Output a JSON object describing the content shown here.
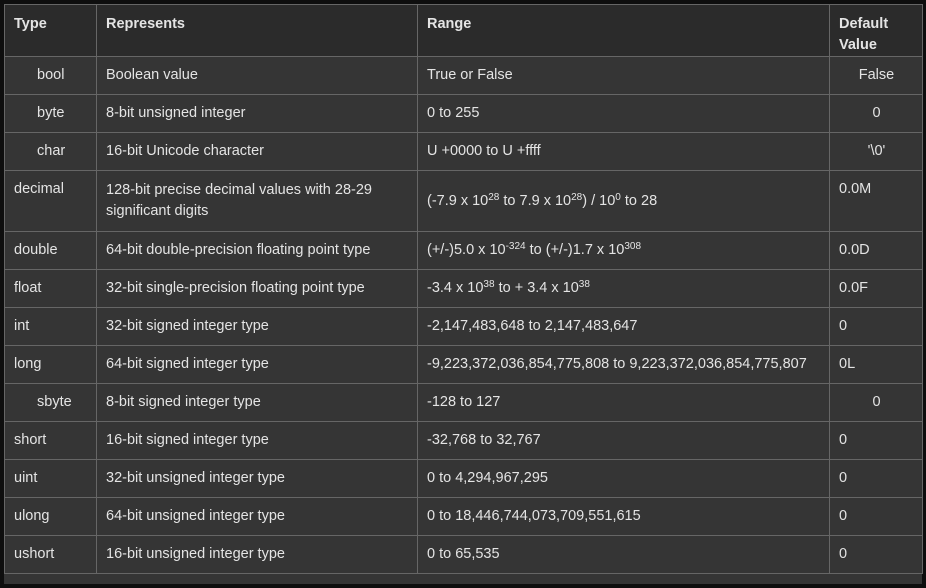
{
  "headers": {
    "type": "Type",
    "represents": "Represents",
    "range": "Range",
    "default": "Default Value"
  },
  "rows": [
    {
      "type": "bool",
      "represents": "Boolean value",
      "range": "True or False",
      "default": "False"
    },
    {
      "type": "byte",
      "represents": "8-bit unsigned integer",
      "range": "0 to 255",
      "default": "0"
    },
    {
      "type": "char",
      "represents": "16-bit Unicode character",
      "range": "U +0000 to U +ffff",
      "default": "'\\0'"
    },
    {
      "type": "decimal",
      "represents": "128-bit precise decimal values with 28-29 significant digits",
      "range_parts": [
        "(-7.9 x 10",
        "28",
        " to 7.9 x 10",
        "28",
        ") / 10",
        "0",
        " to 28"
      ],
      "default": "0.0M"
    },
    {
      "type": "double",
      "represents": "64-bit double-precision floating point type",
      "range_parts": [
        "(+/-)5.0 x 10",
        "-324",
        " to (+/-)1.7 x 10",
        "308"
      ],
      "default": "0.0D"
    },
    {
      "type": "float",
      "represents": "32-bit single-precision floating point type",
      "range_parts": [
        "-3.4 x 10",
        "38",
        " to + 3.4 x 10",
        "38"
      ],
      "default": "0.0F"
    },
    {
      "type": "int",
      "represents": "32-bit signed integer type",
      "range": "-2,147,483,648 to 2,147,483,647",
      "default": "0"
    },
    {
      "type": "long",
      "represents": "64-bit signed integer type",
      "range": "-9,223,372,036,854,775,808 to 9,223,372,036,854,775,807",
      "default": "0L"
    },
    {
      "type": "sbyte",
      "represents": "8-bit signed integer type",
      "range": "-128 to 127",
      "default": "0"
    },
    {
      "type": "short",
      "represents": "16-bit signed integer type",
      "range": "-32,768 to 32,767",
      "default": "0"
    },
    {
      "type": "uint",
      "represents": "32-bit unsigned integer type",
      "range": "0 to 4,294,967,295",
      "default": "0"
    },
    {
      "type": "ulong",
      "represents": "64-bit unsigned integer type",
      "range": "0 to 18,446,744,073,709,551,615",
      "default": "0"
    },
    {
      "type": "ushort",
      "represents": "16-bit unsigned integer type",
      "range": "0 to 65,535",
      "default": "0"
    }
  ]
}
